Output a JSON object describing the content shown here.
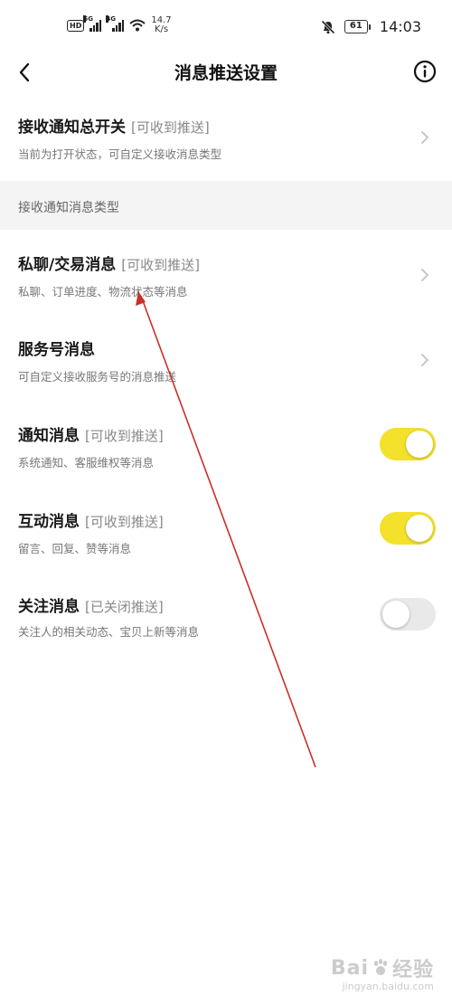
{
  "status_bar": {
    "hd": "HD",
    "sig1": "5G",
    "sig2": "4G",
    "speed_value": "14.7",
    "speed_unit": "K/s",
    "battery": "61",
    "time": "14:03"
  },
  "header": {
    "title": "消息推送设置"
  },
  "master": {
    "title": "接收通知总开关",
    "status": "[可收到推送]",
    "subtitle": "当前为打开状态，可自定义接收消息类型"
  },
  "section_header": "接收通知消息类型",
  "items": [
    {
      "title": "私聊/交易消息",
      "status": "[可收到推送]",
      "subtitle": "私聊、订单进度、物流状态等消息",
      "control": "chevron"
    },
    {
      "title": "服务号消息",
      "status": "",
      "subtitle": "可自定义接收服务号的消息推送",
      "control": "chevron"
    },
    {
      "title": "通知消息",
      "status": "[可收到推送]",
      "subtitle": "系统通知、客服维权等消息",
      "control": "toggle",
      "enabled": true
    },
    {
      "title": "互动消息",
      "status": "[可收到推送]",
      "subtitle": "留言、回复、赞等消息",
      "control": "toggle",
      "enabled": true
    },
    {
      "title": "关注消息",
      "status": "[已关闭推送]",
      "subtitle": "关注人的相关动态、宝贝上新等消息",
      "control": "toggle",
      "enabled": false
    }
  ],
  "colors": {
    "toggle_on": "#f3e12c",
    "toggle_off": "#e9e9e9",
    "annotation_arrow": "#c8302a"
  },
  "watermark": {
    "line1_a": "Bai",
    "line1_b": "经验",
    "line2": "jingyan.baidu.com"
  }
}
